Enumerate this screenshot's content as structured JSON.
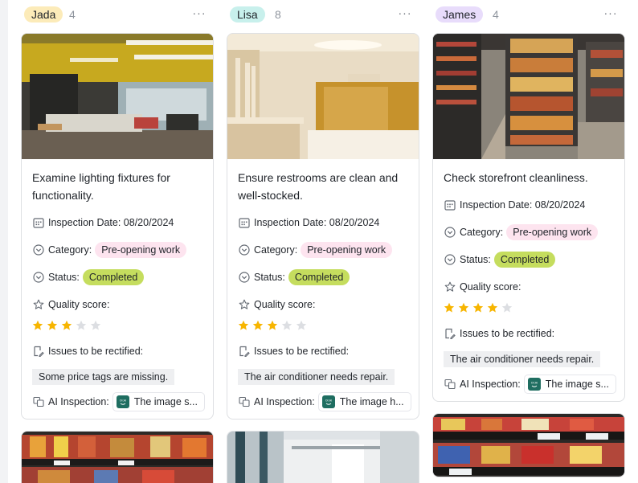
{
  "columns": [
    {
      "owner": "Jada",
      "count": "4",
      "tag_color": "#fcebb9",
      "more_label": "···",
      "card": {
        "image_icon": "office-interior-photo",
        "title": "Examine lighting fixtures for functionality.",
        "inspection_date": "Inspection Date: 08/20/2024",
        "category_label": "Category:",
        "category_value": "Pre-opening work",
        "status_label": "Status:",
        "status_value": "Completed",
        "quality_label": "Quality score:",
        "quality_rating": 3,
        "quality_max": 5,
        "issues_label": "Issues to be rectified:",
        "issues_value": "Some price tags are missing.",
        "ai_label": "AI Inspection:",
        "ai_value": "The image s..."
      },
      "next_card_image": "supermarket-shelf-photo"
    },
    {
      "owner": "Lisa",
      "count": "8",
      "tag_color": "#c8f0ec",
      "more_label": "···",
      "card": {
        "image_icon": "restroom-interior-photo",
        "title": "Ensure restrooms are clean and well-stocked.",
        "inspection_date": "Inspection Date: 08/20/2024",
        "category_label": "Category:",
        "category_value": "Pre-opening work",
        "status_label": "Status:",
        "status_value": "Completed",
        "quality_label": "Quality score:",
        "quality_rating": 3,
        "quality_max": 5,
        "issues_label": "Issues to be rectified:",
        "issues_value": "The air conditioner needs repair.",
        "ai_label": "AI Inspection:",
        "ai_value": "The image h..."
      },
      "next_card_image": "hallway-photo"
    },
    {
      "owner": "James",
      "count": "4",
      "tag_color": "#e8dcfb",
      "more_label": "···",
      "card": {
        "image_icon": "grocery-aisle-photo",
        "title": "Check storefront cleanliness.",
        "inspection_date": "Inspection Date: 08/20/2024",
        "category_label": "Category:",
        "category_value": "Pre-opening work",
        "status_label": "Status:",
        "status_value": "Completed",
        "quality_label": "Quality score:",
        "quality_rating": 4,
        "quality_max": 5,
        "issues_label": "Issues to be rectified:",
        "issues_value": "The air conditioner needs repair.",
        "ai_label": "AI Inspection:",
        "ai_value": "The image s..."
      },
      "next_card_image": "snack-shelf-photo"
    }
  ],
  "colors": {
    "star_filled": "#f7b500",
    "star_empty": "#dcdee2",
    "category_chip": "#fde4ef",
    "status_chip": "#c5dd5e",
    "ai_logo": "#1f6e61"
  },
  "ai_logo_text": "OI:AI"
}
